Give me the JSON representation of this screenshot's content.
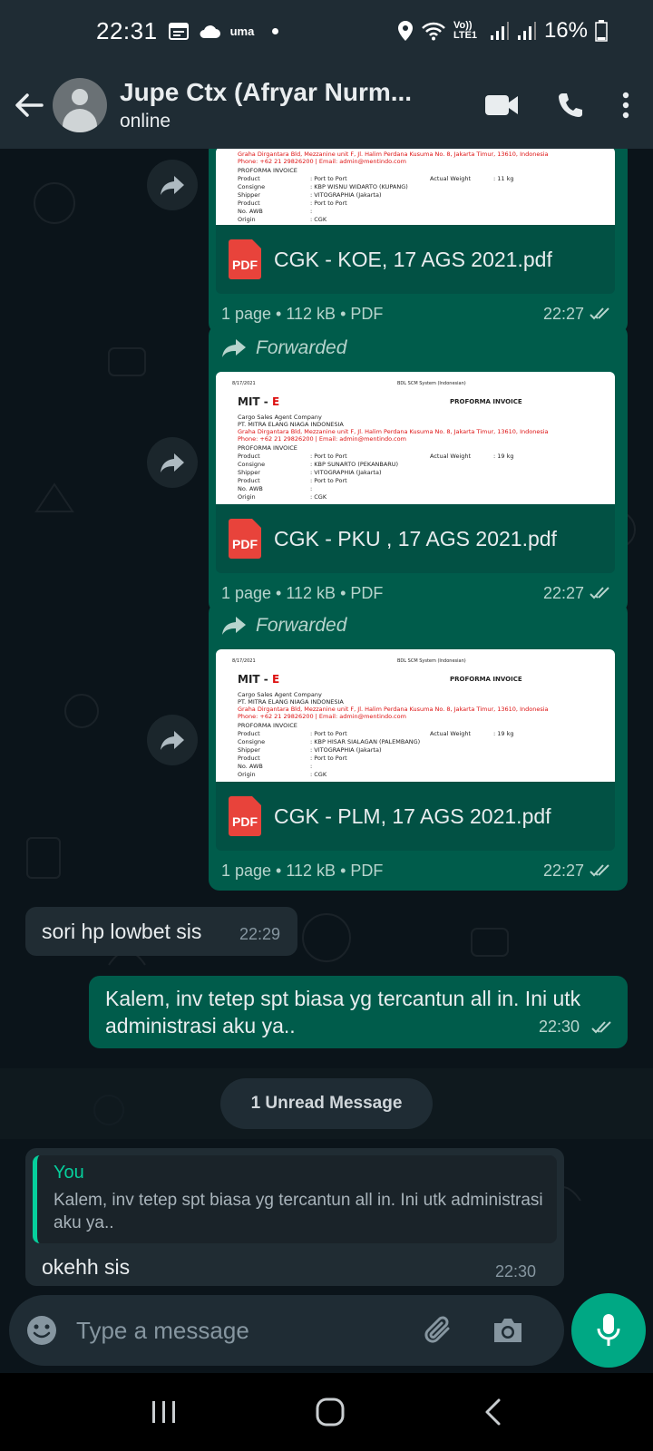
{
  "status_bar": {
    "time": "22:31",
    "carrier_tag": "uma",
    "network": "Vo)) LTE1",
    "battery": "16%"
  },
  "header": {
    "contact_name": "Jupe Ctx (Afryar Nurm...",
    "status": "online"
  },
  "documents": [
    {
      "forwarded": false,
      "forwarded_label": "",
      "preview": {
        "date": "",
        "system": "",
        "logo_prefix": "",
        "logo_suffix": "",
        "doc_type": "",
        "company_type": "",
        "company": "",
        "address": "Graha Dirgantara Bld, Mezzanine unit F, Jl. Halim Perdana Kusuma No. 8, Jakarta Timur, 13610, Indonesia",
        "phone": "Phone: +62 21 29826200 | Email: admin@mentindo.com",
        "section": "PROFORMA INVOICE",
        "rows": [
          {
            "k": "Product",
            "v": ": Port to Port"
          },
          {
            "k": "Consigne",
            "v": ": KBP WISNU WIDARTO (KUPANG)"
          },
          {
            "k": "Shipper",
            "v": ": VITOGRAPHIA (Jakarta)"
          },
          {
            "k": "Product",
            "v": ": Port to Port"
          },
          {
            "k": "No. AWB",
            "v": ":"
          },
          {
            "k": "Origin",
            "v": ": CGK"
          }
        ],
        "weight_label": "Actual Weight",
        "weight_value": ": 11 kg"
      },
      "filename": "CGK - KOE, 17 AGS 2021.pdf",
      "pdf_badge": "PDF",
      "meta": "1 page • 112 kB • PDF",
      "time": "22:27"
    },
    {
      "forwarded": true,
      "forwarded_label": "Forwarded",
      "preview": {
        "date": "8/17/2021",
        "system": "BDL SCM System (Indonesian)",
        "logo_prefix": "MIT - ",
        "logo_suffix": "E",
        "doc_type": "PROFORMA INVOICE",
        "company_type": "Cargo Sales Agent Company",
        "company": "PT. MITRA ELANG NIAGA INDONESIA",
        "address": "Graha Dirgantara Bld, Mezzanine unit F, Jl. Halim Perdana Kusuma No. 8, Jakarta Timur, 13610, Indonesia",
        "phone": "Phone: +62 21 29826200 | Email: admin@mentindo.com",
        "section": "PROFORMA INVOICE",
        "rows": [
          {
            "k": "Product",
            "v": ": Port to Port"
          },
          {
            "k": "Consigne",
            "v": ": KBP SUNARTO (PEKANBARU)"
          },
          {
            "k": "Shipper",
            "v": ": VITOGRAPHIA (Jakarta)"
          },
          {
            "k": "Product",
            "v": ": Port to Port"
          },
          {
            "k": "No. AWB",
            "v": ":"
          },
          {
            "k": "Origin",
            "v": ": CGK"
          }
        ],
        "weight_label": "Actual Weight",
        "weight_value": ": 19 kg"
      },
      "filename": "CGK - PKU , 17 AGS 2021.pdf",
      "pdf_badge": "PDF",
      "meta": "1 page • 112 kB • PDF",
      "time": "22:27"
    },
    {
      "forwarded": true,
      "forwarded_label": "Forwarded",
      "preview": {
        "date": "8/17/2021",
        "system": "BDL SCM System (Indonesian)",
        "logo_prefix": "MIT - ",
        "logo_suffix": "E",
        "doc_type": "PROFORMA INVOICE",
        "company_type": "Cargo Sales Agent Company",
        "company": "PT. MITRA ELANG NIAGA INDONESIA",
        "address": "Graha Dirgantara Bld, Mezzanine unit F, Jl. Halim Perdana Kusuma No. 8, Jakarta Timur, 13610, Indonesia",
        "phone": "Phone: +62 21 29826200 | Email: admin@mentindo.com",
        "section": "PROFORMA INVOICE",
        "rows": [
          {
            "k": "Product",
            "v": ": Port to Port"
          },
          {
            "k": "Consigne",
            "v": ": KBP HISAR SIALAGAN (PALEMBANG)"
          },
          {
            "k": "Shipper",
            "v": ": VITOGRAPHIA (Jakarta)"
          },
          {
            "k": "Product",
            "v": ": Port to Port"
          },
          {
            "k": "No. AWB",
            "v": ":"
          },
          {
            "k": "Origin",
            "v": ": CGK"
          }
        ],
        "weight_label": "Actual Weight",
        "weight_value": ": 19 kg"
      },
      "filename": "CGK - PLM, 17 AGS 2021.pdf",
      "pdf_badge": "PDF",
      "meta": "1 page • 112 kB • PDF",
      "time": "22:27"
    }
  ],
  "messages": {
    "incoming_1": {
      "text": "sori hp lowbet sis",
      "time": "22:29"
    },
    "outgoing_1": {
      "text": "Kalem, inv tetep spt biasa yg tercantun all in. Ini utk administrasi aku ya..",
      "time": "22:30"
    },
    "unread_divider": "1 Unread Message",
    "incoming_2": {
      "quote_author": "You",
      "quote_text": "Kalem, inv tetep spt biasa yg tercantun all in. Ini utk administrasi aku ya..",
      "text": "okehh sis",
      "time": "22:30"
    }
  },
  "composer": {
    "placeholder": "Type a message"
  },
  "colors": {
    "header": "#1f2c34",
    "outgoing": "#005c4b",
    "incoming": "#202c33",
    "accent": "#00a884",
    "quote_bar": "#06cf9c"
  }
}
